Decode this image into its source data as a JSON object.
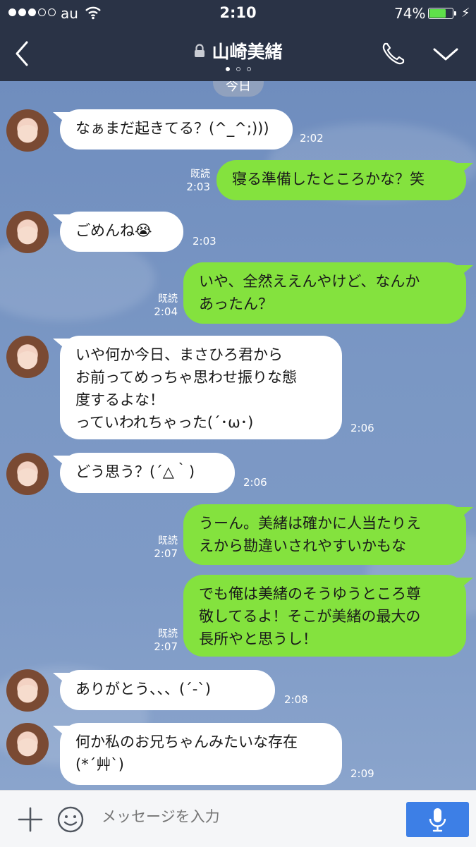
{
  "status": {
    "carrier": "au",
    "time": "2:10",
    "battery": "74%",
    "battery_level": 0.74
  },
  "header": {
    "title": "山崎美緒",
    "page_count": 3,
    "current_page": 0
  },
  "date_label": "今日",
  "messages": [
    {
      "side": "in",
      "text": "なぁまだ起きてる？(^_^;)))",
      "time": "2:02"
    },
    {
      "side": "out",
      "text": "寝る準備したところかな？笑",
      "time": "2:03",
      "read": "既読"
    },
    {
      "side": "in",
      "text": "ごめんね😭",
      "time": "2:03"
    },
    {
      "side": "out",
      "text": "いや、全然ええんやけど、なんか\nあったん？",
      "time": "2:04",
      "read": "既読"
    },
    {
      "side": "in",
      "text": "いや何か今日、まさひろ君から\nお前ってめっちゃ思わせ振りな態\n度するよな！\nっていわれちゃった(´･ω･)",
      "time": "2:06"
    },
    {
      "side": "in",
      "text": "どう思う？(´△｀)",
      "time": "2:06"
    },
    {
      "side": "out",
      "text": "うーん。美緒は確かに人当たりえ\nえから勘違いされやすいかもな",
      "time": "2:07",
      "read": "既読"
    },
    {
      "side": "out",
      "text": "でも俺は美緒のそうゆうところ尊\n敬してるよ！そこが美緒の最大の\n長所やと思うし！",
      "time": "2:07",
      "read": "既読"
    },
    {
      "side": "in",
      "text": "ありがとう、、、(´-`)",
      "time": "2:08"
    },
    {
      "side": "in",
      "text": "何か私のお兄ちゃんみたいな存在\n(*´艸`)",
      "time": "2:09"
    }
  ],
  "input": {
    "placeholder": "メッセージを入力"
  },
  "icons": {
    "back": "chevron-left-icon",
    "lock": "lock-icon",
    "call": "phone-icon",
    "menu": "chevron-down-icon",
    "add": "plus-icon",
    "emoji": "smiley-icon",
    "mic": "microphone-icon"
  },
  "colors": {
    "header": "#2a3346",
    "outgoing": "#84e23e",
    "incoming": "#ffffff",
    "mic": "#3d7fe6"
  }
}
